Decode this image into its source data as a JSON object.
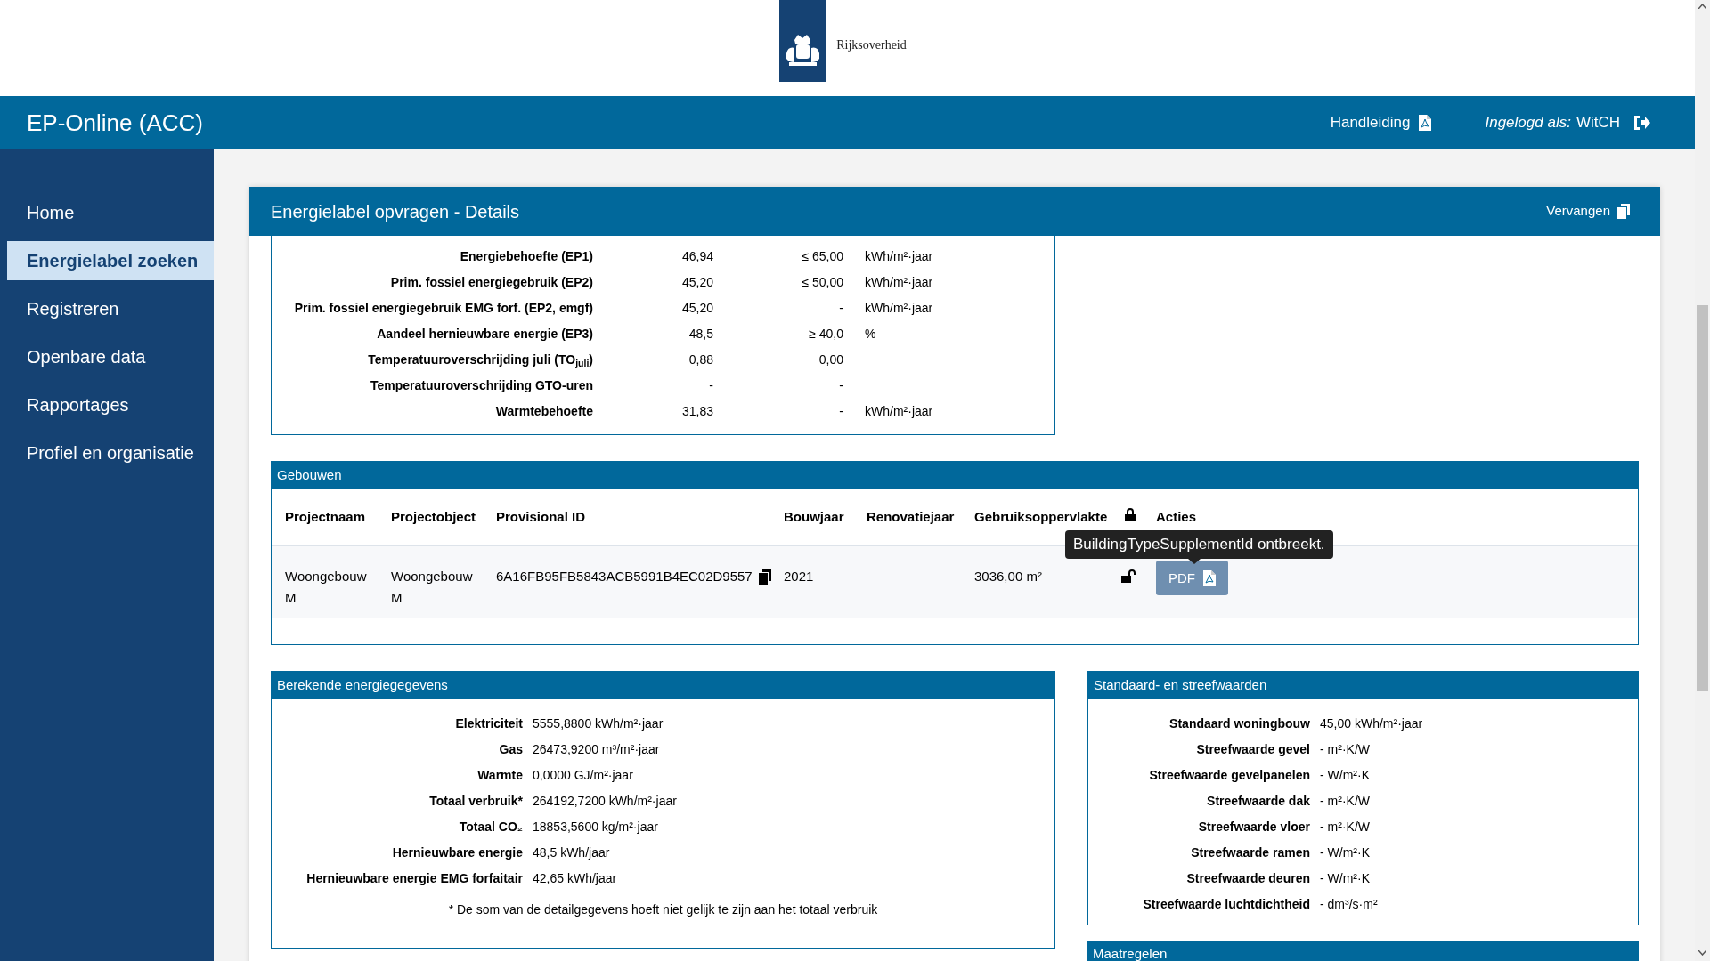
{
  "header": {
    "logo_text": "Rijksoverheid"
  },
  "navbar": {
    "title": "EP-Online (ACC)",
    "manual_link": "Handleiding",
    "login_label": "Ingelogd als:",
    "user": "WitCH"
  },
  "sidebar": {
    "items": [
      {
        "label": "Home",
        "selected": false
      },
      {
        "label": "Energielabel zoeken",
        "selected": true
      },
      {
        "label": "Registreren",
        "selected": false
      },
      {
        "label": "Openbare data",
        "selected": false
      },
      {
        "label": "Rapportages",
        "selected": false
      },
      {
        "label": "Profiel en organisatie",
        "selected": false
      }
    ]
  },
  "panel": {
    "title": "Energielabel opvragen - Details",
    "action": "Vervangen"
  },
  "indicators": [
    {
      "label": "Energiebehoefte (EP1)",
      "value": "46,94",
      "norm": "≤ 65,00",
      "unit": "kWh/m²·jaar"
    },
    {
      "label": "Prim. fossiel energiegebruik (EP2)",
      "value": "45,20",
      "norm": "≤ 50,00",
      "unit": "kWh/m²·jaar"
    },
    {
      "label": "Prim. fossiel energiegebruik EMG forf. (EP2, emgf)",
      "value": "45,20",
      "norm": "-",
      "unit": "kWh/m²·jaar"
    },
    {
      "label": "Aandeel hernieuwbare energie (EP3)",
      "value": "48,5",
      "norm": "≥ 40,0",
      "unit": "%"
    },
    {
      "label": "Temperatuuroverschrijding juli (TO$_{juli}$)",
      "value": "0,88",
      "norm": "0,00"
    },
    {
      "label": "Temperatuuroverschrijding GTO-uren",
      "value": "-",
      "norm": "-"
    },
    {
      "label": "Warmtebehoefte",
      "value": "31,83",
      "norm": "-",
      "unit": "kWh/m²·jaar"
    }
  ],
  "buildings": {
    "title": "Gebouwen",
    "columns": [
      {
        "kind": "text",
        "label": "Projectnaam"
      },
      {
        "kind": "text",
        "label": "Projectobject"
      },
      {
        "kind": "text",
        "label": "Provisional ID"
      },
      {
        "kind": "text",
        "label": "Bouwjaar"
      },
      {
        "kind": "text",
        "label": "Renovatiejaar"
      },
      {
        "kind": "text",
        "label": "Gebruiksoppervlakte"
      },
      {
        "kind": "lock"
      },
      {
        "kind": "text",
        "label": "Acties"
      }
    ],
    "rows": [
      {
        "projectnaam": "Woongebouw M",
        "projectobject": "Woongebouw M",
        "provisional_id": "6A16FB95FB5843ACB5991B4EC02D9557",
        "bouwjaar": "2021",
        "gebruiksoppervlakte": "3036,00 m²",
        "locked": false,
        "action": "PDF"
      }
    ],
    "tooltip": "BuildingTypeSupplementId ontbreekt."
  },
  "energy": {
    "title": "Berekende energiegegevens",
    "rows": [
      {
        "label": "Elektriciteit",
        "value": "5555,8800 kWh/m²·jaar"
      },
      {
        "label": "Gas",
        "value": "26473,9200 m³/m²·jaar"
      },
      {
        "label": "Warmte",
        "value": "0,0000 GJ/m²·jaar"
      },
      {
        "label": "Totaal verbruik*",
        "value": "264192,7200 kWh/m²·jaar"
      },
      {
        "label": "Totaal CO₂",
        "value": "18853,5600 kg/m²·jaar"
      },
      {
        "label": "Hernieuwbare energie",
        "value": "48,5 kWh/jaar"
      },
      {
        "label": "Hernieuwbare energie EMG forfaitair",
        "value": "42,65 kWh/jaar"
      }
    ],
    "footnote": "* De som van de detailgegevens hoeft niet gelijk te zijn aan het totaal verbruik"
  },
  "standards": {
    "title": "Standaard- en streefwaarden",
    "rows": [
      {
        "label": "Standaard woningbouw",
        "value": "45,00 kWh/m²·jaar"
      },
      {
        "label": "Streefwaarde gevel",
        "value": "- m²·K/W"
      },
      {
        "label": "Streefwaarde gevelpanelen",
        "value": "- W/m²·K"
      },
      {
        "label": "Streefwaarde dak",
        "value": "- m²·K/W"
      },
      {
        "label": "Streefwaarde vloer",
        "value": "- m²·K/W"
      },
      {
        "label": "Streefwaarde ramen",
        "value": "- W/m²·K"
      },
      {
        "label": "Streefwaarde deuren",
        "value": "- W/m²·K"
      },
      {
        "label": "Streefwaarde luchtdichtheid",
        "value": "- dm³/s·m²"
      }
    ]
  },
  "measures": {
    "title": "Maatregelen"
  }
}
